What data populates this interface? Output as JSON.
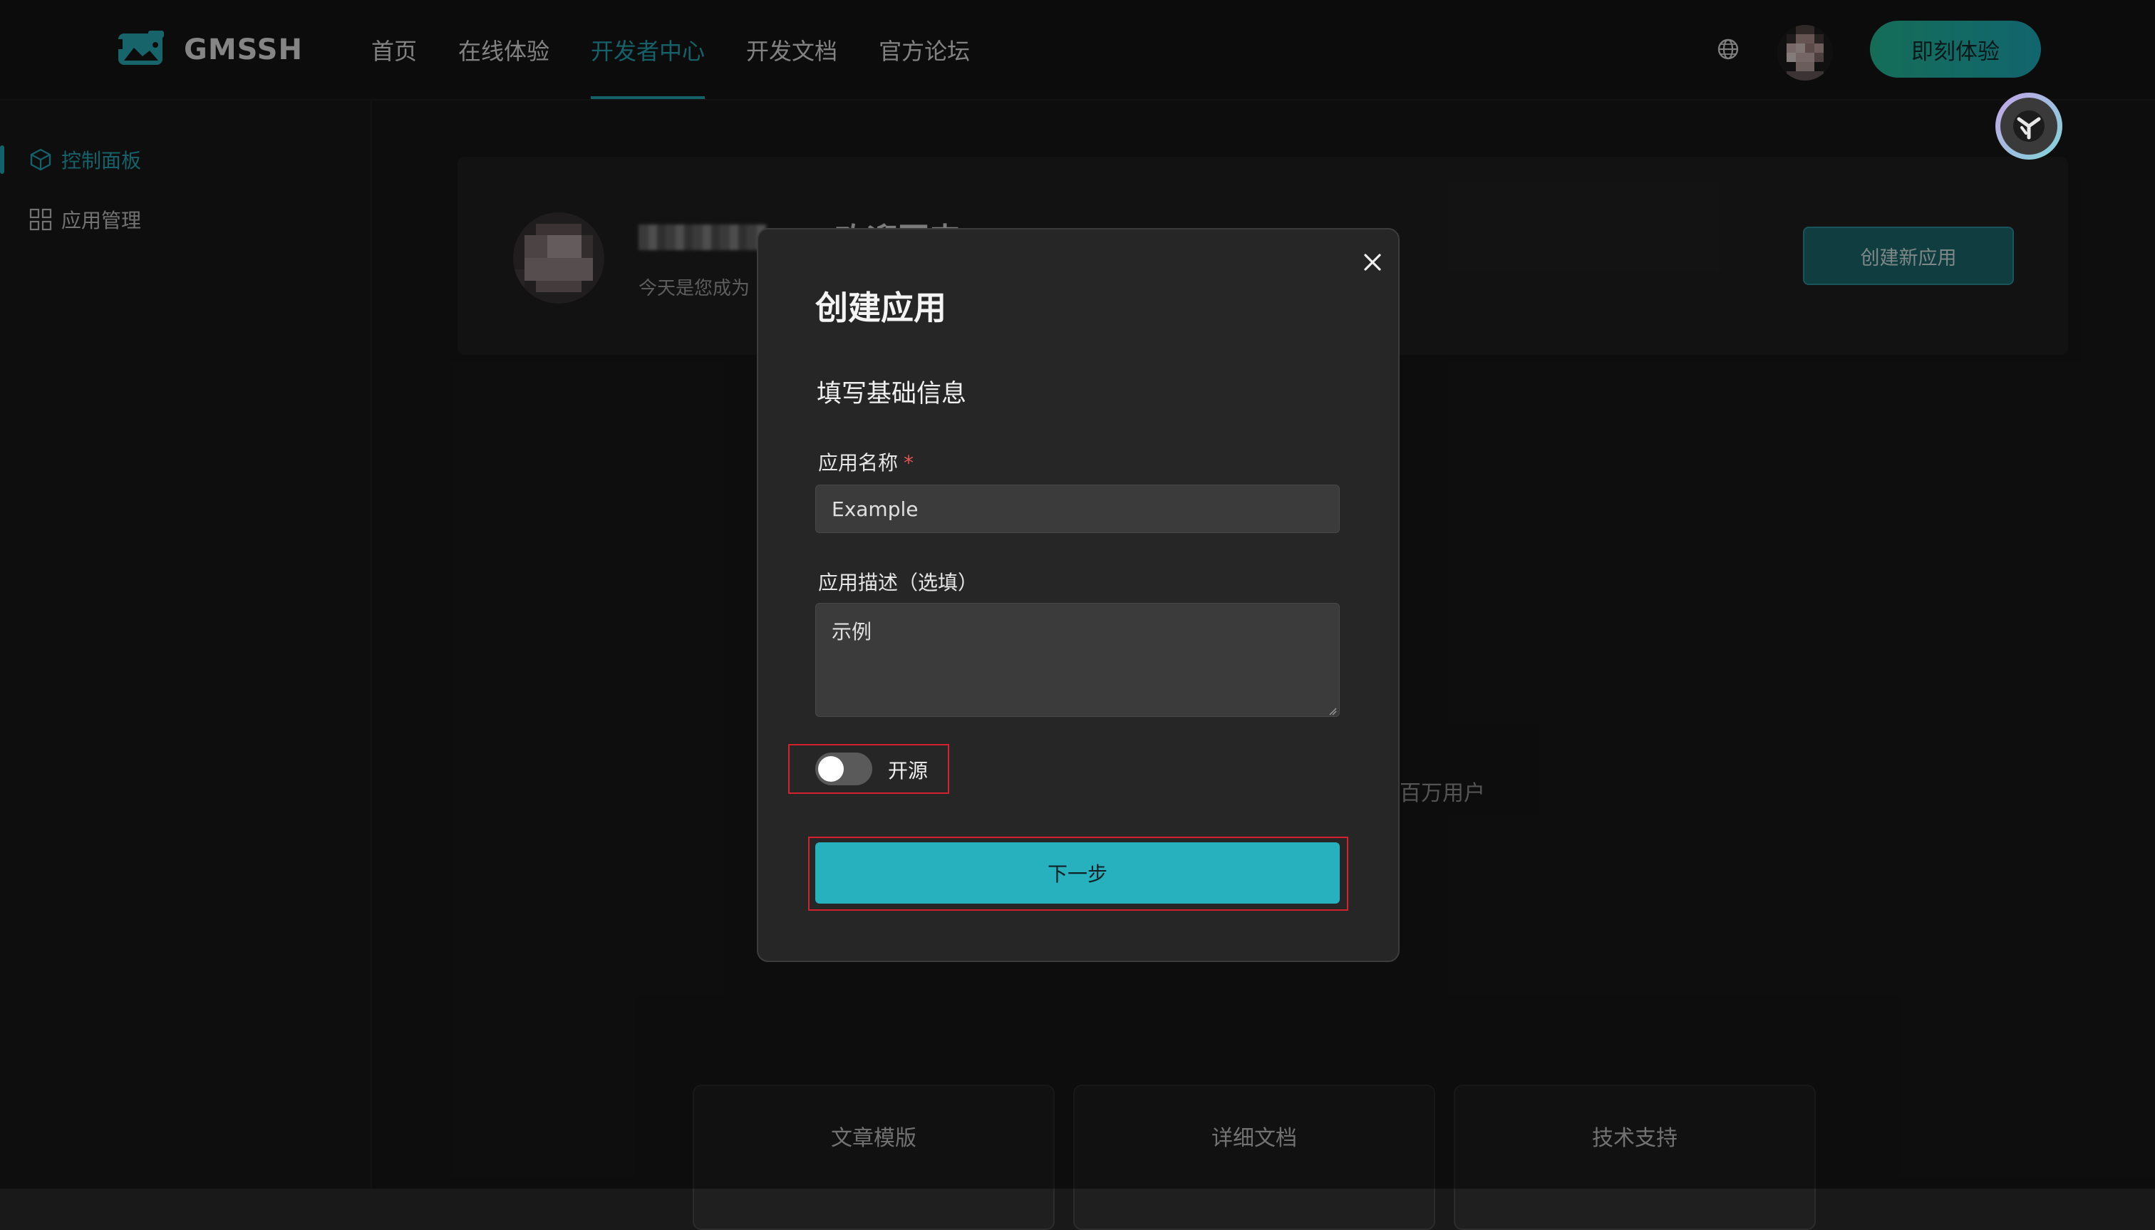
{
  "app": {
    "brand": "GMSSH"
  },
  "nav": {
    "items": [
      {
        "label": "首页"
      },
      {
        "label": "在线体验"
      },
      {
        "label": "开发者中心"
      },
      {
        "label": "开发文档"
      },
      {
        "label": "官方论坛"
      }
    ],
    "active_index": 2,
    "cta_label": "即刻体验",
    "globe_icon": "globe-icon",
    "help_icon": "help-assistant-icon"
  },
  "sidebar": {
    "items": [
      {
        "label": "控制面板",
        "icon": "cube-icon",
        "active": true
      },
      {
        "label": "应用管理",
        "icon": "grid-icon",
        "active": false
      }
    ]
  },
  "welcome": {
    "title": "欢迎回来",
    "subtitle": "今天是您成为",
    "create_button": "创建新应用"
  },
  "background": {
    "stat_text": "百万用户",
    "cards": [
      {
        "label": "文章模版"
      },
      {
        "label": "详细文档"
      },
      {
        "label": "技术支持"
      }
    ]
  },
  "modal": {
    "title": "创建应用",
    "section_title": "填写基础信息",
    "name_label": "应用名称",
    "required_mark": "*",
    "name_value": "Example",
    "desc_label": "应用描述（选填）",
    "desc_value": "示例",
    "open_source_label": "开源",
    "open_source_enabled": false,
    "next_button": "下一步",
    "close_icon": "close-icon"
  },
  "colors": {
    "accent": "#27b1bf",
    "cta_gradient_start": "#27c7a0",
    "highlight_border": "#d3222e",
    "background": "#191919"
  }
}
